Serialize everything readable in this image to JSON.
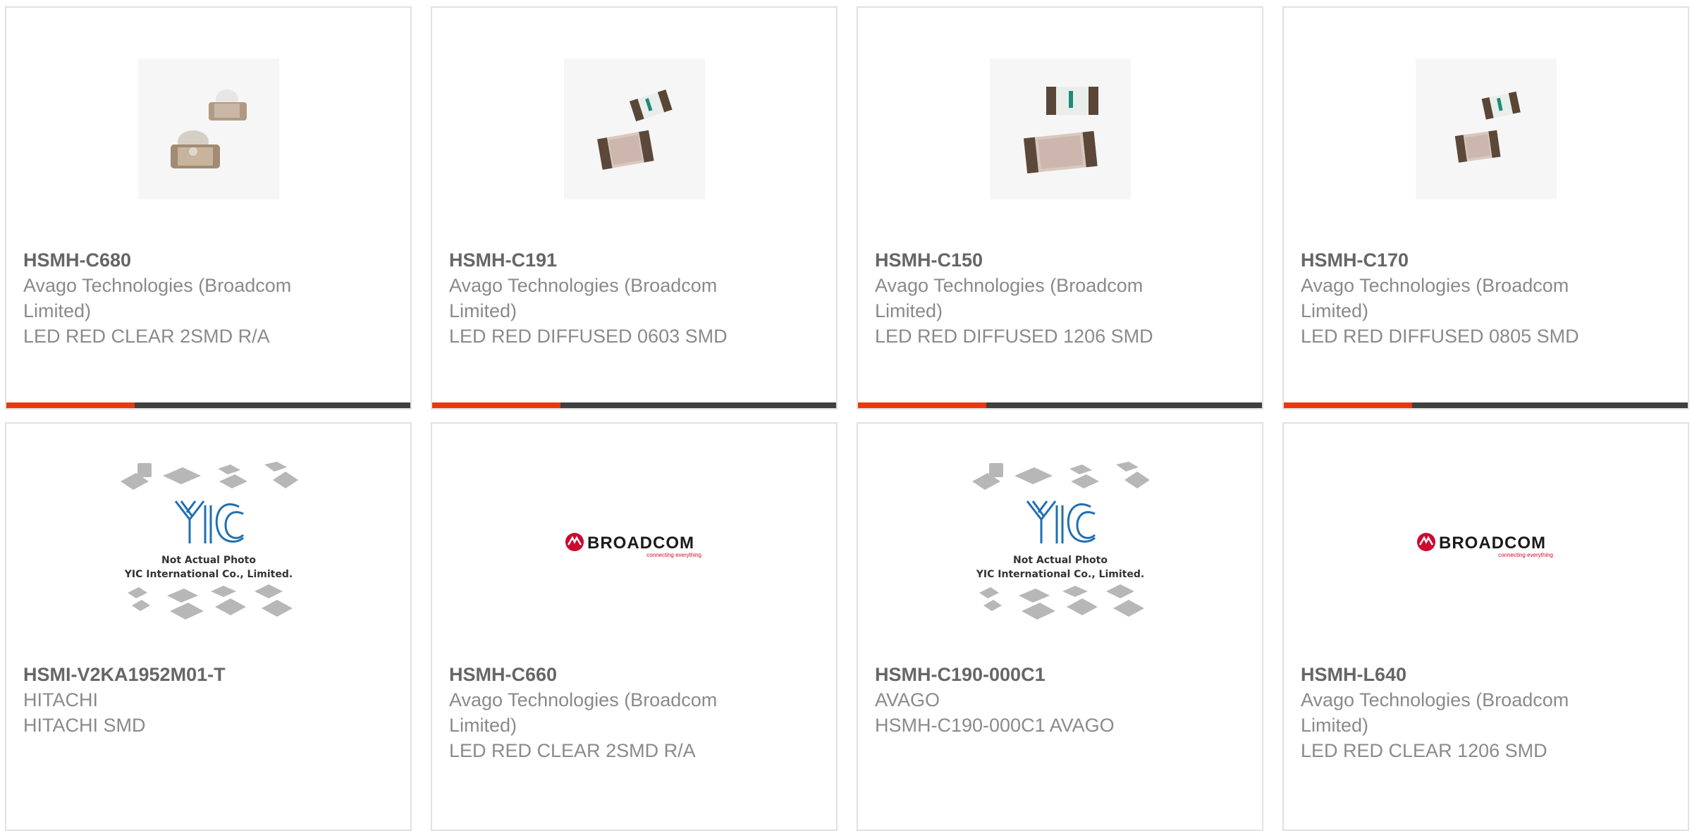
{
  "colors": {
    "accent": "#e8380d",
    "bar": "#3f3f3f",
    "border": "#e1e1e1",
    "broadcom_red": "#cc092f",
    "yic_blue": "#1f6fb2"
  },
  "products": [
    {
      "part_number": "HSMH-C680",
      "manufacturer": "Avago Technologies (Broadcom Limited)",
      "description": "LED RED CLEAR 2SMD R/A",
      "image": "led-right-angle-photo"
    },
    {
      "part_number": "HSMH-C191",
      "manufacturer": "Avago Technologies (Broadcom Limited)",
      "description": "LED RED DIFFUSED 0603 SMD",
      "image": "led-chip-photo"
    },
    {
      "part_number": "HSMH-C150",
      "manufacturer": "Avago Technologies (Broadcom Limited)",
      "description": "LED RED DIFFUSED 1206 SMD",
      "image": "led-chip-photo"
    },
    {
      "part_number": "HSMH-C170",
      "manufacturer": "Avago Technologies (Broadcom Limited)",
      "description": "LED RED DIFFUSED 0805 SMD",
      "image": "led-chip-photo"
    },
    {
      "part_number": "HSMI-V2KA1952M01-T",
      "manufacturer": "HITACHI",
      "description": "HITACHI SMD",
      "image": "yic-placeholder",
      "image_caption": [
        "Not Actual Photo",
        "YIC International Co., Limited."
      ]
    },
    {
      "part_number": "HSMH-C660",
      "manufacturer": "Avago Technologies (Broadcom Limited)",
      "description": "LED RED CLEAR 2SMD R/A",
      "image": "broadcom-logo",
      "logo_text": "BROADCOM",
      "logo_tagline": "connecting everything"
    },
    {
      "part_number": "HSMH-C190-000C1",
      "manufacturer": "AVAGO",
      "description": "HSMH-C190-000C1 AVAGO",
      "image": "yic-placeholder",
      "image_caption": [
        "Not Actual Photo",
        "YIC International Co., Limited."
      ]
    },
    {
      "part_number": "HSMH-L640",
      "manufacturer": "Avago Technologies (Broadcom Limited)",
      "description": "LED RED CLEAR 1206 SMD",
      "image": "broadcom-logo",
      "logo_text": "BROADCOM",
      "logo_tagline": "connecting everything"
    }
  ]
}
